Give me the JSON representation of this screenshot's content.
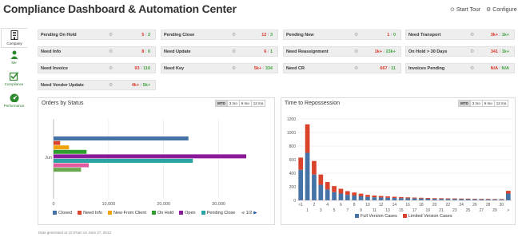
{
  "header": {
    "title": "Compliance Dashboard & Automation Center",
    "start_tour": "Start Tour",
    "configure": "Configure"
  },
  "sidebar": {
    "items": [
      {
        "label": "Company",
        "icon": "building-icon"
      },
      {
        "label": "Me",
        "icon": "user-icon"
      },
      {
        "label": "Compliance",
        "icon": "checkbox-icon"
      },
      {
        "label": "Performance",
        "icon": "dashboard-icon"
      }
    ]
  },
  "kpis": [
    {
      "name": "Pending On Hold",
      "red": "5",
      "green": "2"
    },
    {
      "name": "Pending Close",
      "red": "12",
      "green": "3"
    },
    {
      "name": "Pending New",
      "red": "1",
      "green": "0"
    },
    {
      "name": "Need Transport",
      "red": "3k+",
      "green": "1k+"
    },
    {
      "name": "Need Info",
      "red": "8",
      "green": "0"
    },
    {
      "name": "Need Update",
      "red": "6",
      "green": "1"
    },
    {
      "name": "Need Reassignment",
      "red": "1k+",
      "green": "23k+"
    },
    {
      "name": "On Hold > 30 Days",
      "red": "341",
      "green": "1k+"
    },
    {
      "name": "Need Invoice",
      "red": "93",
      "green": "116"
    },
    {
      "name": "Need Key",
      "red": "5k+",
      "green": "334"
    },
    {
      "name": "Need CR",
      "red": "667",
      "green": "11"
    },
    {
      "name": "Invoices Pending",
      "red": "N/A",
      "green": "N/A"
    },
    {
      "name": "Need Vendor Update",
      "red": "4k+",
      "green": "5k+"
    }
  ],
  "orders_panel": {
    "title": "Orders by Status",
    "tabs": [
      "MTD",
      "3 mo",
      "6 mo",
      "12 mo"
    ],
    "active_tab": "MTD",
    "pager": "1/2"
  },
  "repo_panel": {
    "title": "Time to Repossession",
    "tabs": [
      "MTD",
      "3 mo",
      "6 mo",
      "12 mo"
    ],
    "active_tab": "MTD"
  },
  "footer": "Data generated at 12:57am on June 27, 2013",
  "chart_data": [
    {
      "type": "bar",
      "orientation": "horizontal",
      "categories": [
        "Jun"
      ],
      "series": [
        {
          "name": "Closed",
          "color": "#4572a7",
          "values": [
            24500
          ]
        },
        {
          "name": "Need Info",
          "color": "#d9432b",
          "values": [
            1200
          ]
        },
        {
          "name": "New From Client",
          "color": "#f0a30a",
          "values": [
            2800
          ]
        },
        {
          "name": "On Hold",
          "color": "#2f9e2f",
          "values": [
            6000
          ]
        },
        {
          "name": "Open",
          "color": "#8b1a9a",
          "values": [
            35000
          ]
        },
        {
          "name": "Pending Close",
          "color": "#2aa3a3",
          "values": [
            25300
          ]
        },
        {
          "name": "",
          "color": "#e05aa0",
          "values": [
            6400
          ]
        },
        {
          "name": "",
          "color": "#6aa84f",
          "values": [
            5000
          ]
        }
      ],
      "legend_visible": [
        "Closed",
        "Need Info",
        "New From Client",
        "On Hold",
        "Open",
        "Pending Close"
      ],
      "xlim": [
        0,
        35000
      ],
      "xticks": [
        "0",
        "10,000",
        "20,000",
        "30,000"
      ],
      "grid": true
    },
    {
      "type": "bar",
      "stacked": true,
      "categories": [
        "<1",
        "1",
        "2",
        "3",
        "4",
        "5",
        "6",
        "7",
        "8",
        "9",
        "10",
        "11",
        "12",
        "13",
        "14",
        "15",
        "16",
        "17",
        "18",
        "19",
        "20",
        "21",
        "22",
        "23",
        "24",
        "25",
        "26",
        "27",
        "28",
        "29",
        "30",
        ">"
      ],
      "xticklabels_row1": [
        "<1",
        "2",
        "4",
        "6",
        "8",
        "10",
        "12",
        "14",
        "16",
        "18",
        "20",
        "22",
        "24",
        "26",
        "28",
        "30"
      ],
      "xticklabels_row2": [
        "1",
        "3",
        "5",
        "7",
        "9",
        "11",
        "13",
        "15",
        "17",
        "19",
        "21",
        "23",
        "25",
        "27",
        "29",
        ">"
      ],
      "series": [
        {
          "name": "Full Version Cases",
          "color": "#4572a7",
          "values": [
            450,
            700,
            380,
            230,
            160,
            120,
            100,
            80,
            70,
            60,
            50,
            45,
            42,
            38,
            35,
            32,
            30,
            28,
            26,
            24,
            22,
            21,
            20,
            19,
            18,
            17,
            16,
            15,
            14,
            13,
            12,
            100
          ]
        },
        {
          "name": "Limited Version Cases",
          "color": "#d9432b",
          "values": [
            180,
            420,
            200,
            150,
            110,
            90,
            70,
            55,
            45,
            38,
            30,
            25,
            22,
            20,
            18,
            16,
            14,
            13,
            12,
            11,
            10,
            10,
            9,
            9,
            8,
            8,
            7,
            7,
            7,
            6,
            6,
            40
          ]
        }
      ],
      "ylim": [
        0,
        1200
      ],
      "yticks": [
        "0",
        "200",
        "400",
        "600",
        "800",
        "1000",
        "1200"
      ],
      "grid": true,
      "legend_placement": "bottom"
    }
  ]
}
